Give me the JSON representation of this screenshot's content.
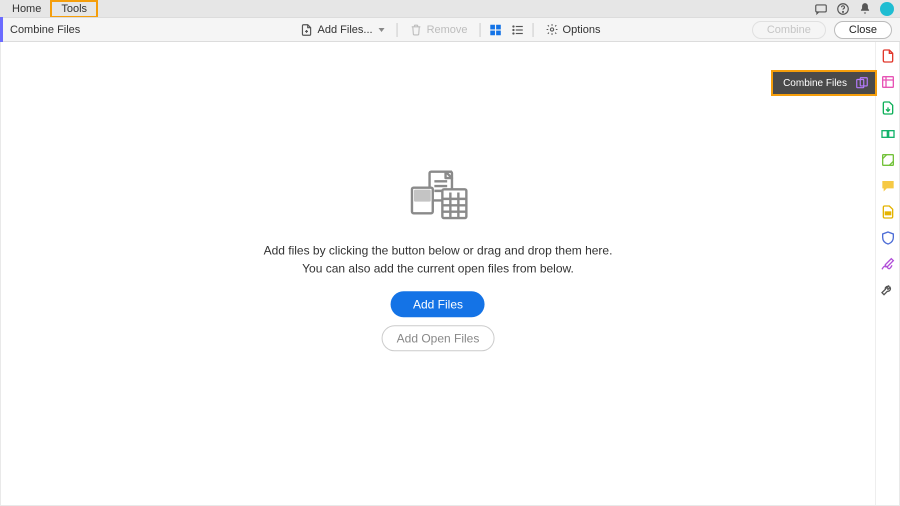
{
  "menubar": {
    "tabs": [
      {
        "label": "Home"
      },
      {
        "label": "Tools",
        "highlighted": true
      }
    ],
    "icons": {
      "chat": "chat-icon",
      "help": "help-icon",
      "bell": "bell-icon",
      "avatar": "user-avatar"
    }
  },
  "toolbar": {
    "title": "Combine Files",
    "add_files_label": "Add Files...",
    "remove_label": "Remove",
    "options_label": "Options",
    "combine_label": "Combine",
    "close_label": "Close",
    "view_mode": "grid"
  },
  "empty_state": {
    "line1": "Add files by clicking the button below or drag and drop them here.",
    "line2": "You can also add the current open files from below.",
    "add_files_button": "Add Files",
    "add_open_files_button": "Add Open Files"
  },
  "flyout": {
    "label": "Combine Files"
  },
  "right_rail": {
    "tools": [
      "create-pdf-icon",
      "combine-files-icon",
      "edit-pdf-icon",
      "export-pdf-icon",
      "organize-pages-icon",
      "comment-icon",
      "redact-icon",
      "protect-icon",
      "fill-sign-icon",
      "more-tools-icon"
    ]
  },
  "colors": {
    "accent": "#1473e6",
    "highlight_outline": "#f59e0b",
    "tab_accent": "#6b6bff",
    "avatar": "#1fbdd2"
  }
}
